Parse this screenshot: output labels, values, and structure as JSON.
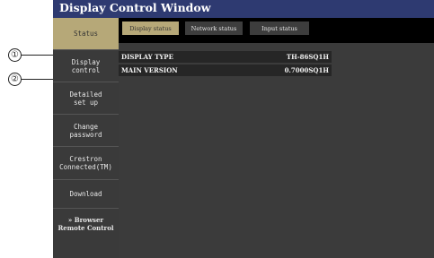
{
  "window": {
    "title": "Display Control Window"
  },
  "callouts": [
    "①",
    "②"
  ],
  "sidebar": {
    "items": [
      {
        "label": "Status",
        "active": true
      },
      {
        "label": "Display\ncontrol",
        "active": false
      },
      {
        "label": "Detailed\nset up",
        "active": false
      },
      {
        "label": "Change\npassword",
        "active": false
      },
      {
        "label": "Crestron\nConnected(TM)",
        "active": false
      },
      {
        "label": "Download",
        "active": false
      },
      {
        "label": "» Browser\nRemote Control",
        "active": false
      }
    ]
  },
  "tabs": [
    {
      "label": "Display status",
      "active": true
    },
    {
      "label": "Network status",
      "active": false
    },
    {
      "label": "Input status",
      "active": false
    }
  ],
  "status_rows": [
    {
      "label": "DISPLAY TYPE",
      "value": "TH-86SQ1H"
    },
    {
      "label": "MAIN VERSION",
      "value": "0.7000SQ1H"
    }
  ],
  "colors": {
    "titlebar": "#2e3a71",
    "active_accent": "#b6a878",
    "sidebar_bg": "#3a3a3a",
    "content_bg": "#3b3b3b"
  }
}
